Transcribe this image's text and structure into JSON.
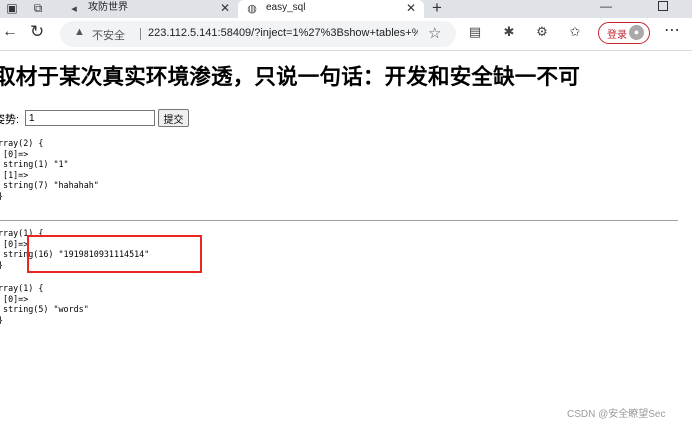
{
  "browser": {
    "tabs": [
      {
        "title": "攻防世界",
        "icon": "page-icon",
        "active": false
      },
      {
        "title": "easy_sql",
        "icon": "globe-icon",
        "active": true
      }
    ],
    "address": {
      "security_label": "不安全",
      "url": "223.112.5.141:58409/?inject=1%27%3Bshow+tables+%..."
    },
    "login_label": "登录"
  },
  "page": {
    "heading": "取材于某次真实环境渗透，只说一句话：开发和安全缺一不可",
    "form": {
      "label": "姿势:",
      "value": "1",
      "submit_label": "提交"
    },
    "dump1": "rray(2) {\n [0]=>\n string(1) \"1\"\n [1]=>\n string(7) \"hahahah\"\n}",
    "dump2": "rray(1) {\n [0]=>\n string(16) \"1919810931114514\"\n}",
    "dump3": "rray(1) {\n [0]=>\n string(5) \"words\"\n}"
  },
  "watermark": "CSDN @安全瞭望Sec",
  "colors": {
    "highlight": "#e8281f",
    "login": "#c0272d",
    "tabbar": "#dfe3e8"
  }
}
